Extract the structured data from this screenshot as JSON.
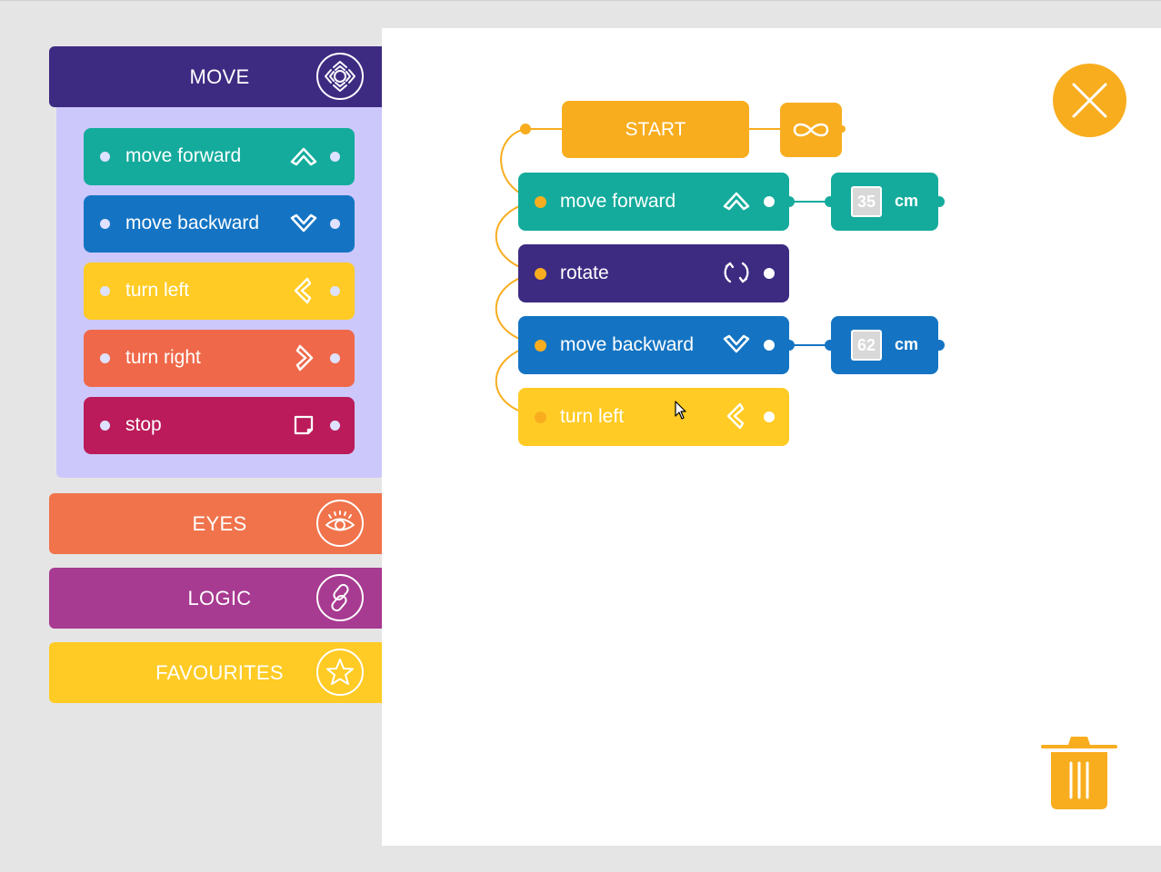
{
  "palette": {
    "categories": [
      {
        "label": "MOVE",
        "color": "#3d2b82",
        "icon": "dpad-icon"
      },
      {
        "label": "EYES",
        "color": "#f0734b",
        "icon": "eye-icon"
      },
      {
        "label": "LOGIC",
        "color": "#a73a91",
        "icon": "link-icon"
      },
      {
        "label": "FAVOURITES",
        "color": "#ffcb24",
        "icon": "star-icon"
      }
    ],
    "move_blocks": [
      {
        "label": "move forward",
        "color": "#14ab9c",
        "icon": "chevron-up-icon"
      },
      {
        "label": "move backward",
        "color": "#1474c3",
        "icon": "chevron-down-icon"
      },
      {
        "label": "turn left",
        "color": "#ffcb24",
        "icon": "chevron-left-icon"
      },
      {
        "label": "turn right",
        "color": "#f0684a",
        "icon": "chevron-right-icon"
      },
      {
        "label": "stop",
        "color": "#bb1b5a",
        "icon": "stop-icon"
      }
    ]
  },
  "program": {
    "start_label": "START",
    "loop_icon": "infinity-icon",
    "blocks": [
      {
        "label": "move forward",
        "color": "#14ab9c",
        "icon": "chevron-up-icon",
        "value": "35",
        "unit": "cm"
      },
      {
        "label": "rotate",
        "color": "#3d2b82",
        "icon": "rotate-icon"
      },
      {
        "label": "move backward",
        "color": "#1474c3",
        "icon": "chevron-down-icon",
        "value": "62",
        "unit": "cm"
      },
      {
        "label": "turn left",
        "color": "#ffcb24",
        "icon": "chevron-left-icon"
      }
    ]
  },
  "controls": {
    "close_icon": "close-icon",
    "trash_icon": "trash-icon"
  }
}
